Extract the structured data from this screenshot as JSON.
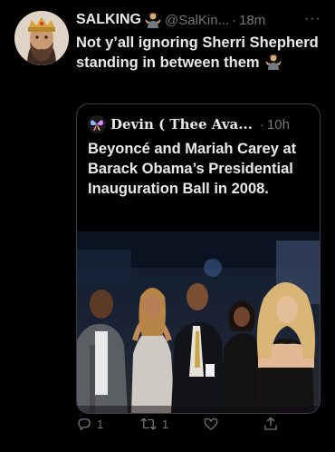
{
  "tweet": {
    "author_name": "SALKING",
    "author_handle": "@SalKin...",
    "separator": "·",
    "time": "18m",
    "more_label": "···",
    "text": "Not y’all ignoring Sherri Shepherd standing in between them"
  },
  "quoted": {
    "author_name": "Devin ( Thee Ava...",
    "separator": "·",
    "time": "10h",
    "text": "Beyoncé and Mariah Carey at Barack Obama’s Presidential Inauguration Ball in 2008."
  },
  "actions": {
    "reply_count": "1",
    "retweet_count": "1",
    "like_count": "",
    "share_count": ""
  },
  "icons": {
    "reply": "reply-icon",
    "retweet": "retweet-icon",
    "like": "heart-icon",
    "share": "share-icon",
    "emoji": "person-shrugging-emoji-icon"
  },
  "colors": {
    "background": "#000000",
    "text": "#e7e9ea",
    "muted": "#71767b",
    "border": "#3b3f43"
  }
}
